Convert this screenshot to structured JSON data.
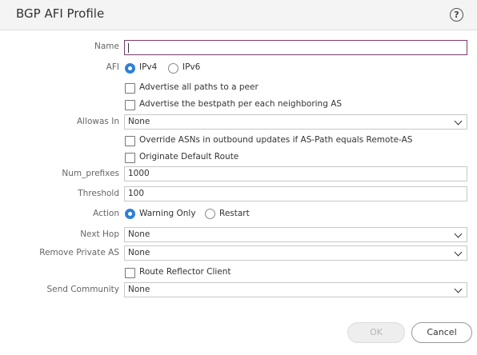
{
  "dialog": {
    "title": "BGP AFI Profile",
    "help_symbol": "?"
  },
  "form": {
    "name": {
      "label": "Name",
      "value": ""
    },
    "afi": {
      "label": "AFI",
      "options": [
        {
          "label": "IPv4",
          "selected": true
        },
        {
          "label": "IPv6",
          "selected": false
        }
      ]
    },
    "advertise_all_paths": {
      "label": "Advertise all paths to a peer",
      "checked": false
    },
    "advertise_bestpath": {
      "label": "Advertise the bestpath per each neighboring AS",
      "checked": false
    },
    "allowas_in": {
      "label": "Allowas In",
      "value": "None"
    },
    "override_asns": {
      "label": "Override ASNs in outbound updates if AS-Path equals Remote-AS",
      "checked": false
    },
    "originate_default": {
      "label": "Originate Default Route",
      "checked": false
    },
    "num_prefixes": {
      "label": "Num_prefixes",
      "value": "1000"
    },
    "threshold": {
      "label": "Threshold",
      "value": "100"
    },
    "action": {
      "label": "Action",
      "options": [
        {
          "label": "Warning Only",
          "selected": true
        },
        {
          "label": "Restart",
          "selected": false
        }
      ]
    },
    "next_hop": {
      "label": "Next Hop",
      "value": "None"
    },
    "remove_private_as": {
      "label": "Remove Private AS",
      "value": "None"
    },
    "route_reflector_client": {
      "label": "Route Reflector Client",
      "checked": false
    },
    "send_community": {
      "label": "Send Community",
      "value": "None"
    }
  },
  "footer": {
    "ok_label": "OK",
    "cancel_label": "Cancel"
  },
  "colors": {
    "accent_radio": "#2f7fd6",
    "active_field_border": "#7a3b6c"
  }
}
